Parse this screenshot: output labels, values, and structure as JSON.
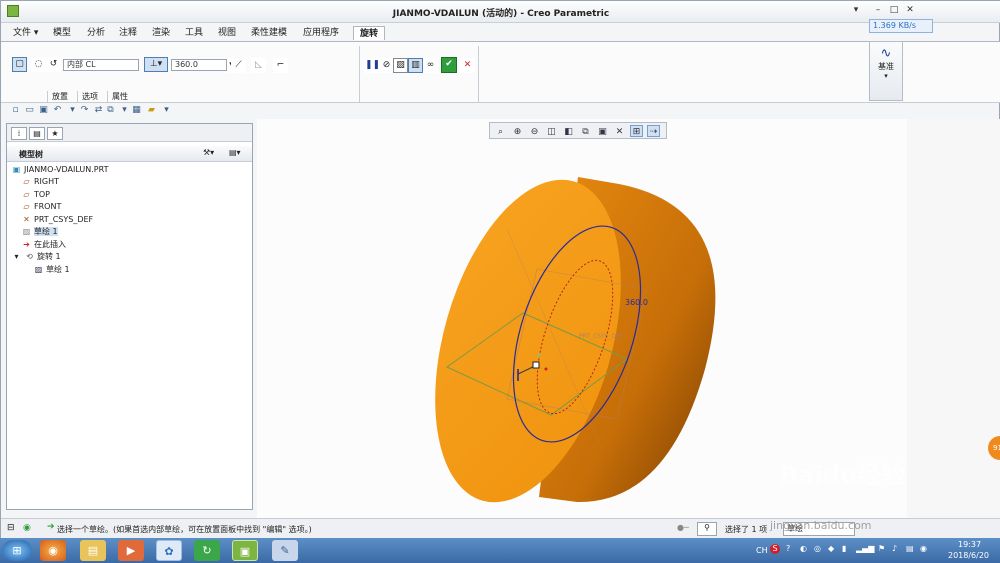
{
  "window": {
    "title": "JIANMO-VDAILUN (活动的) - Creo Parametric",
    "min_icon": "minimize-icon",
    "max_icon": "maximize-icon",
    "close_icon": "close-icon"
  },
  "menu": {
    "tabs": [
      {
        "label": "文件 ▾"
      },
      {
        "label": "模型"
      },
      {
        "label": "分析"
      },
      {
        "label": "注释"
      },
      {
        "label": "渲染"
      },
      {
        "label": "工具"
      },
      {
        "label": "视图"
      },
      {
        "label": "柔性建模"
      },
      {
        "label": "应用程序"
      },
      {
        "label": "旋转"
      }
    ]
  },
  "network_speed": "1.369 KB/s",
  "ribbon": {
    "axis_field": "内部 CL",
    "angle_field": "360.0",
    "subtabs": [
      "放置",
      "选项",
      "属性"
    ],
    "datum_label": "基准"
  },
  "model_tree": {
    "header": "模型树",
    "items": [
      {
        "label": "JIANMO-VDAILUN.PRT",
        "icon": "part-icon"
      },
      {
        "label": "RIGHT",
        "icon": "datum-plane-icon"
      },
      {
        "label": "TOP",
        "icon": "datum-plane-icon"
      },
      {
        "label": "FRONT",
        "icon": "datum-plane-icon"
      },
      {
        "label": "PRT_CSYS_DEF",
        "icon": "csys-icon"
      },
      {
        "label": "草绘 1",
        "icon": "sketch-icon"
      },
      {
        "label": "在此插入",
        "icon": "insert-arrow-icon"
      },
      {
        "label": "旋转 1",
        "icon": "revolve-icon"
      },
      {
        "label": "草绘 1",
        "icon": "sketch-icon"
      }
    ]
  },
  "viewport": {
    "dimension_label": "360.0",
    "csys_label": "PRT_CSYS_DEF"
  },
  "status": {
    "message": "选择一个草绘。(如果首选内部草绘，可在放置面板中找到 \"编辑\" 选项。)",
    "selected": "选择了 1 项",
    "filter": "草绘"
  },
  "taskbar": {
    "ime": "CH",
    "time": "19:37",
    "date": "2018/6/20"
  },
  "watermark": {
    "text": "Baidu经验",
    "url": "jingyan.baidu.com"
  },
  "colors": {
    "part_orange": "#f0930e",
    "taskbar_blue": "#3b6aa5",
    "sketch_blue": "#2a2a9a"
  }
}
